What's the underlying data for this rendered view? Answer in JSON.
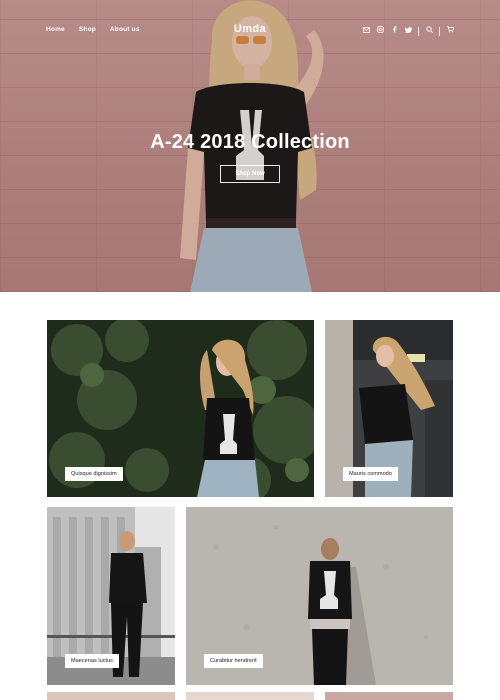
{
  "nav": {
    "links": [
      "Home",
      "Shop",
      "About us"
    ],
    "brand": "Umda",
    "icons": [
      "mail-icon",
      "instagram-icon",
      "facebook-icon",
      "twitter-icon",
      "search-icon",
      "cart-icon"
    ]
  },
  "hero": {
    "title": "A-24 2018 Collection",
    "button": "Shop Now"
  },
  "products": [
    {
      "label": "Quisque dignissim"
    },
    {
      "label": "Mauris commodo"
    },
    {
      "label": "Maecenas luctus"
    },
    {
      "label": "Curabitur hendrerit"
    }
  ]
}
